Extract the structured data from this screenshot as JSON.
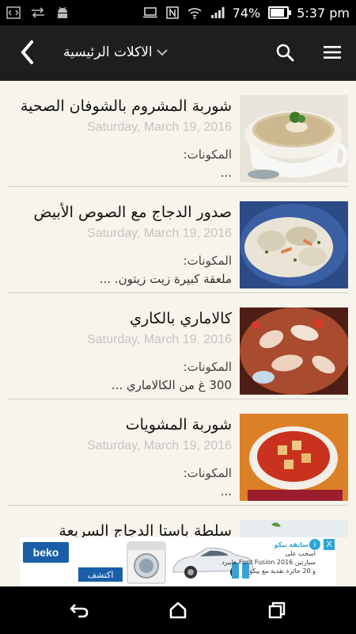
{
  "status_bar": {
    "battery": "74%",
    "time": "5:37 pm",
    "left_icons": [
      "code-icon",
      "sync-arrows-icon",
      "android-icon"
    ],
    "right_icons": [
      "laptop-icon",
      "nfc-icon",
      "wifi-icon",
      "signal-icon",
      "battery-icon"
    ],
    "battery_level": 0.74
  },
  "app_bar": {
    "title": "الاكلات الرئيسية",
    "background": "#1e1e1e"
  },
  "recipes": [
    {
      "title": "شوربة المشروم بالشوفان الصحية",
      "date": "Saturday, March 19, 2016",
      "ingredients_label": "المكونات:",
      "snippet": "...",
      "image": "mushroom-soup-image"
    },
    {
      "title": "صدور الدجاج مع الصوص الأبيض",
      "date": "Saturday, March 19, 2016",
      "ingredients_label": "المكونات:",
      "snippet": "ملعقة كبيرة زيت زيتون. ...",
      "image": "chicken-white-sauce-image"
    },
    {
      "title": "كالاماري بالكاري",
      "date": "Saturday, March 19, 2016",
      "ingredients_label": "المكونات:",
      "snippet": "300 غ من الكالاماري ...",
      "image": "calamari-image"
    },
    {
      "title": "شوربة المشويات",
      "date": "Saturday, March 19, 2016",
      "ingredients_label": "المكونات:",
      "snippet": "...",
      "image": "grilled-soup-image"
    },
    {
      "title": "سلطة باستا الدجاج السريعة",
      "date": "",
      "ingredients_label": "",
      "snippet": "",
      "image": "pasta-salad-image"
    }
  ],
  "ad": {
    "brand": "beko",
    "button_label": "اكتشف",
    "text_lines": [
      "...سابقة بيكو",
      "اسحب على",
      "سيارتين Ford Fusion 2016 هايبرد",
      "و 20 جائزة نقدية مع بيكو"
    ],
    "info_icon": "i",
    "close_icon": "X"
  },
  "colors": {
    "accent_ad": "#1a5ea8",
    "date_gray": "#c4c4c4",
    "background": "#f7f4ec"
  }
}
